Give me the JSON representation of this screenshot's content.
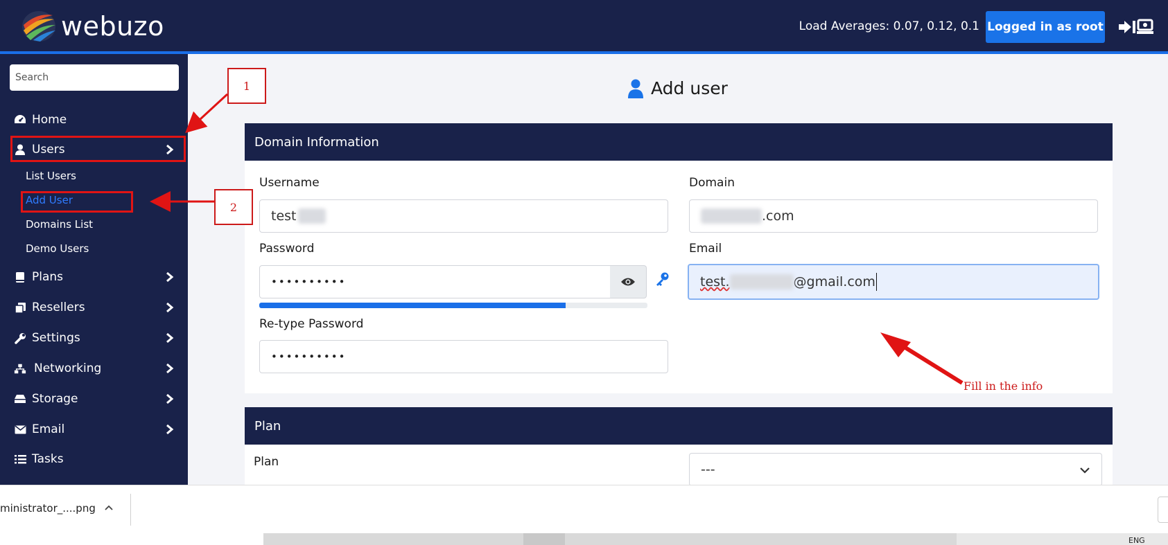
{
  "header": {
    "brand": "webuzo",
    "load_averages": "Load Averages: 0.07, 0.12, 0.1",
    "login_label": "Logged in as root"
  },
  "sidebar": {
    "search_placeholder": "Search",
    "items": [
      {
        "label": "Home",
        "icon": "dashboard-icon"
      },
      {
        "label": "Users",
        "icon": "user-icon"
      },
      {
        "label": "Plans",
        "icon": "book-icon"
      },
      {
        "label": "Resellers",
        "icon": "copy-icon"
      },
      {
        "label": "Settings",
        "icon": "wrench-icon"
      },
      {
        "label": "Networking",
        "icon": "network-icon"
      },
      {
        "label": "Storage",
        "icon": "hdd-icon"
      },
      {
        "label": "Email",
        "icon": "envelope-icon"
      },
      {
        "label": "Tasks",
        "icon": "list-icon"
      }
    ],
    "users_sub": [
      "List Users",
      "Add User",
      "Domains List",
      "Demo Users"
    ]
  },
  "page": {
    "title": "Add user",
    "domain_section": {
      "title": "Domain Information",
      "username_label": "Username",
      "username_value": "test",
      "domain_label": "Domain",
      "domain_value": ".com",
      "password_label": "Password",
      "password_value": "••••••••••",
      "password_strength": 0.79,
      "email_label": "Email",
      "email_prefix": "test.",
      "email_suffix": "@gmail.com",
      "retype_label": "Re-type Password",
      "retype_value": "••••••••••"
    },
    "plan_section": {
      "title": "Plan",
      "plan_label": "Plan",
      "plan_value": "---"
    }
  },
  "annotations": {
    "step1": "1",
    "step2": "2",
    "note": "Fill in the info"
  },
  "download_bar": {
    "filename": "ministrator_....png"
  },
  "taskbar": {
    "lang": "ENG"
  },
  "colors": {
    "navy": "#19224a",
    "accent": "#1a73e8",
    "annotation": "#e01414"
  }
}
